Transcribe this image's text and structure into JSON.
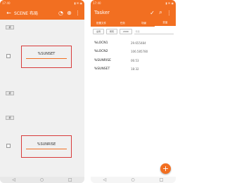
{
  "left": {
    "status_time": "17:40",
    "status_icons": "▮ ✉ ◉",
    "title": "SCENE 布局",
    "buttons": [
      "按",
      "按",
      "按"
    ],
    "edit_text_1": "%SUNSET",
    "edit_text_2": "%SUNRISE",
    "nav": {
      "back": "◁",
      "home": "○",
      "recent": "□"
    }
  },
  "right": {
    "status_time": "17:40",
    "status_icons": "▮ ✉ ◉",
    "title": "Tasker",
    "tabs": [
      "配置文件",
      "任务",
      "场景",
      "变量"
    ],
    "filter_pills": [
      "全局",
      "所有",
      "2000"
    ],
    "search_placeholder": "筛选",
    "variables": [
      {
        "name": "%LOCN1",
        "value": "29.655484"
      },
      {
        "name": "%LOCN2",
        "value": "106.585780"
      },
      {
        "name": "%SUNRISE",
        "value": "06:53"
      },
      {
        "name": "%SUNSET",
        "value": "18:32"
      }
    ],
    "fab_label": "+",
    "nav": {
      "back": "◁",
      "home": "○",
      "recent": "□"
    }
  },
  "colors": {
    "accent": "#f26f21",
    "highlight_border": "#d83a3a"
  }
}
